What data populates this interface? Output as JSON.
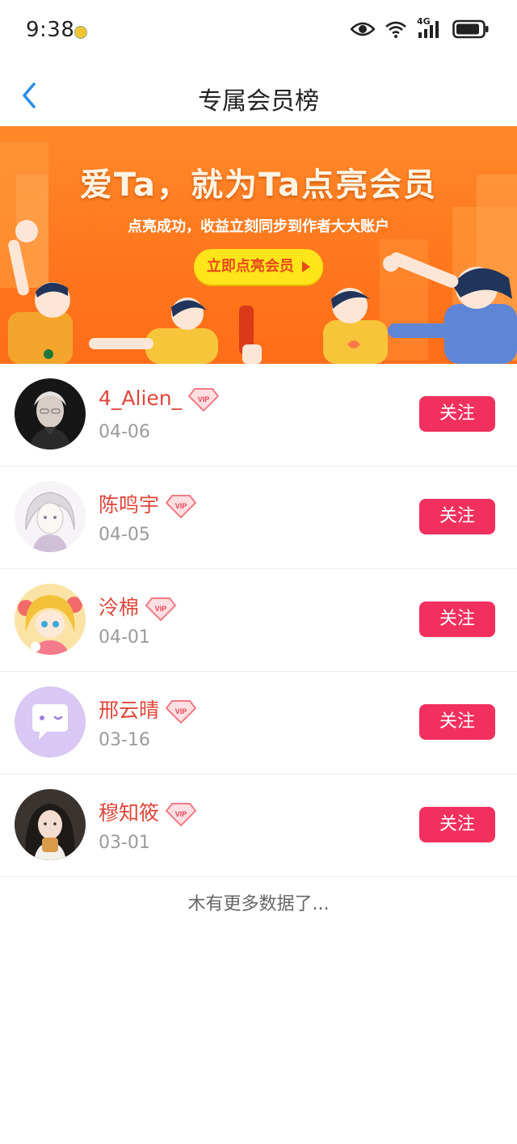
{
  "status_bar": {
    "time": "9:38",
    "network": "4G"
  },
  "nav": {
    "title": "专属会员榜"
  },
  "banner": {
    "title": "爱Ta，就为Ta点亮会员",
    "subtitle": "点亮成功，收益立刻同步到作者大大账户",
    "button": "立即点亮会员",
    "colors": {
      "background": "#ff7a1e",
      "button": "#ffe51a"
    }
  },
  "members": [
    {
      "name": "4_Alien_",
      "date": "04-06",
      "follow": "关注",
      "avatar": "avatar-photo-dark"
    },
    {
      "name": "陈鸣宇",
      "date": "04-05",
      "follow": "关注",
      "avatar": "avatar-anime-sketch"
    },
    {
      "name": "泠棉",
      "date": "04-01",
      "follow": "关注",
      "avatar": "avatar-anime-yellow"
    },
    {
      "name": "邢云晴",
      "date": "03-16",
      "follow": "关注",
      "avatar": "avatar-default-chat"
    },
    {
      "name": "穆知筱",
      "date": "03-01",
      "follow": "关注",
      "avatar": "avatar-photo-girl"
    }
  ],
  "vip_badge": "VIP",
  "footer": "木有更多数据了...",
  "colors": {
    "accent_red": "#f2305e",
    "name_red": "#e0453a",
    "back_blue": "#2b8fe6"
  }
}
